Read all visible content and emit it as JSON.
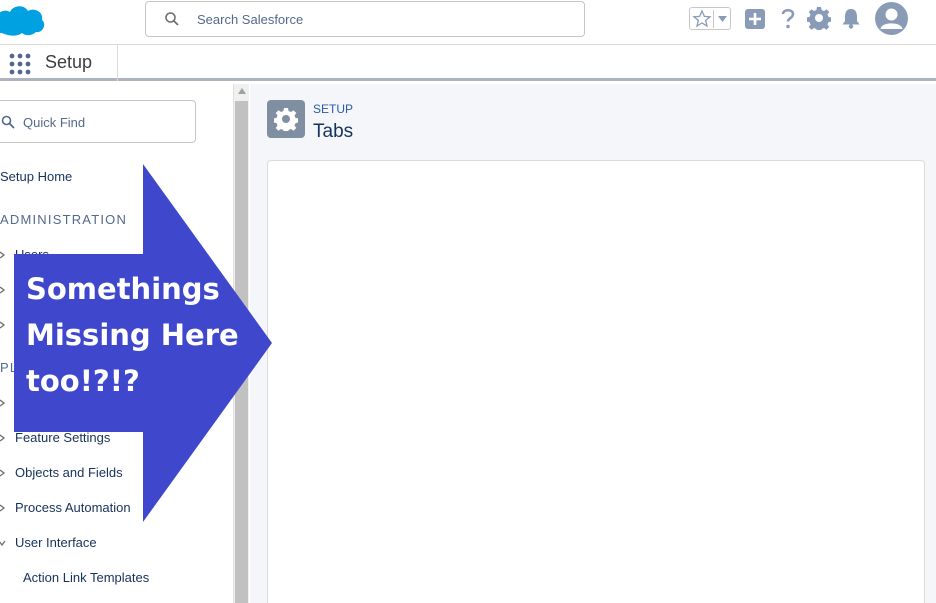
{
  "header": {
    "search_placeholder": "Search Salesforce",
    "colors": {
      "brand": "#00a1e0",
      "icon": "#8a9bb7"
    },
    "icons": [
      "cloud-logo-icon",
      "star-icon",
      "plus-icon",
      "help-icon",
      "gear-icon",
      "bell-icon",
      "user-icon"
    ]
  },
  "setup_bar": {
    "title": "Setup"
  },
  "sidebar": {
    "quick_find_placeholder": "Quick Find",
    "setup_home": "Setup Home",
    "section_admin": "ADMINISTRATION",
    "section_platform": "PL",
    "items": [
      {
        "label": "Users",
        "expanded": false
      },
      {
        "label": "Feature Settings",
        "expanded": false
      },
      {
        "label": "Objects and Fields",
        "expanded": false
      },
      {
        "label": "Process Automation",
        "expanded": false
      },
      {
        "label": "User Interface",
        "expanded": true
      },
      {
        "label": "Action Link Templates",
        "expanded": false
      }
    ]
  },
  "main": {
    "breadcrumb": "SETUP",
    "title": "Tabs"
  },
  "annotation": {
    "lines": [
      "Somethings",
      "Missing Here",
      "too!?!?"
    ],
    "color": "#3f48cc"
  }
}
